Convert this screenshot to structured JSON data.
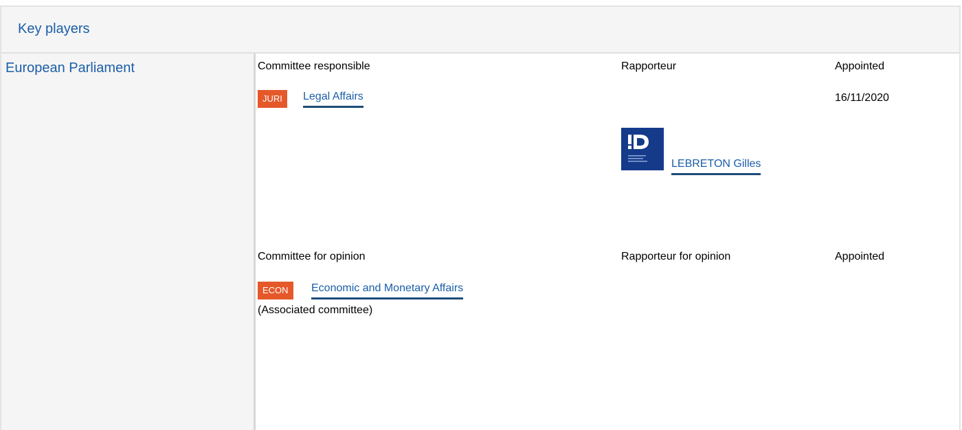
{
  "header": {
    "title": "Key players"
  },
  "left": {
    "institution": "European Parliament"
  },
  "responsible": {
    "heading_committee": "Committee responsible",
    "heading_rapporteur": "Rapporteur",
    "heading_appointed": "Appointed",
    "committee_code": "JURI",
    "committee_name": "Legal Affairs",
    "appointed_date": "16/11/2020",
    "rapporteur_name": "LEBRETON Gilles",
    "group_logo_icon": "id-group-logo-icon"
  },
  "opinion": {
    "heading_committee": "Committee for opinion",
    "heading_rapporteur": "Rapporteur for opinion",
    "heading_appointed": "Appointed",
    "committee_code": "ECON",
    "committee_name": "Economic and Monetary Affairs",
    "note": "(Associated committee)"
  },
  "colors": {
    "accent_blue": "#1a5ea8",
    "badge_orange": "#e5582a",
    "panel_gray": "#f5f5f5",
    "group_navy": "#153a8a"
  }
}
